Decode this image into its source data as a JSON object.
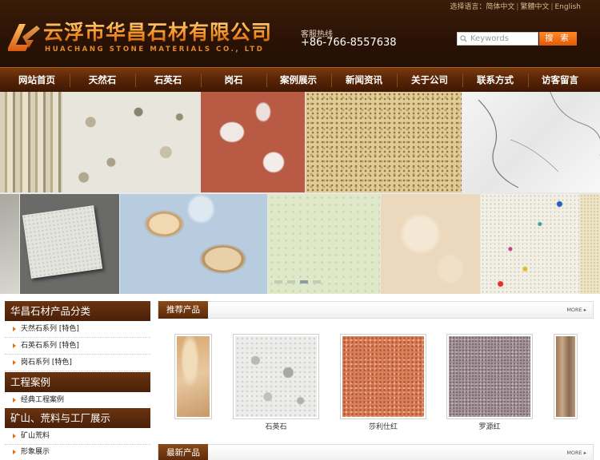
{
  "header": {
    "logo_cn": "云浮市华昌石材有限公司",
    "logo_en": "HUACHANG STONE MATERIALS CO., LTD",
    "hotline_label": "客服热线",
    "hotline_phone": "+86-766-8557638",
    "language": {
      "label": "选择语言：",
      "simplified": "简体中文",
      "traditional": "繁體中文",
      "english": "English"
    },
    "search": {
      "placeholder": "Keywords",
      "button_label": "搜 索"
    },
    "brand_color": "#f08a20"
  },
  "nav": {
    "items": [
      "网站首页",
      "天然石",
      "石英石",
      "岗石",
      "案例展示",
      "新闻资讯",
      "关于公司",
      "联系方式",
      "访客留言"
    ]
  },
  "banner": {
    "dot_count": 4,
    "active_dot": 3
  },
  "sidebar": {
    "sections": [
      {
        "title": "华昌石材产品分类",
        "items": [
          "天然石系列 [特色]",
          "石英石系列 [特色]",
          "岗石系列 [特色]"
        ]
      },
      {
        "title": "工程案例",
        "items": [
          "经典工程案例"
        ]
      },
      {
        "title": "矿山、荒料与工厂展示",
        "items": [
          "矿山荒料",
          "形象展示"
        ]
      }
    ]
  },
  "recommended": {
    "title": "推荐产品",
    "more_label": "MORE ▸",
    "products": [
      {
        "name": "",
        "color": "#d9b48a"
      },
      {
        "name": "石英石",
        "color": "#e2e2e0"
      },
      {
        "name": "莎利仕红",
        "color": "#d8845c"
      },
      {
        "name": "罗源红",
        "color": "#a29498"
      },
      {
        "name": "",
        "color": "#b89070"
      }
    ]
  },
  "latest": {
    "title": "最新产品",
    "more_label": "MORE ▸"
  }
}
